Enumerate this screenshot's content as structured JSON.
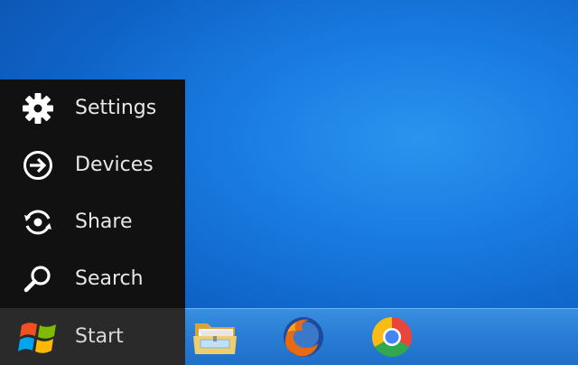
{
  "charms": {
    "items": [
      {
        "label": "Settings",
        "icon": "gear-icon"
      },
      {
        "label": "Devices",
        "icon": "devices-icon"
      },
      {
        "label": "Share",
        "icon": "share-icon"
      },
      {
        "label": "Search",
        "icon": "search-icon"
      }
    ]
  },
  "start": {
    "label": "Start",
    "icon": "windows-logo-icon"
  },
  "taskbar": {
    "pinned": [
      {
        "icon": "file-explorer-icon"
      },
      {
        "icon": "firefox-icon"
      },
      {
        "icon": "chrome-icon"
      }
    ]
  },
  "colors": {
    "charm_bg": "#111111",
    "start_bg": "#2a2a2a",
    "taskbar": "#2b7fd6",
    "desktop": "#1a7ee4"
  }
}
